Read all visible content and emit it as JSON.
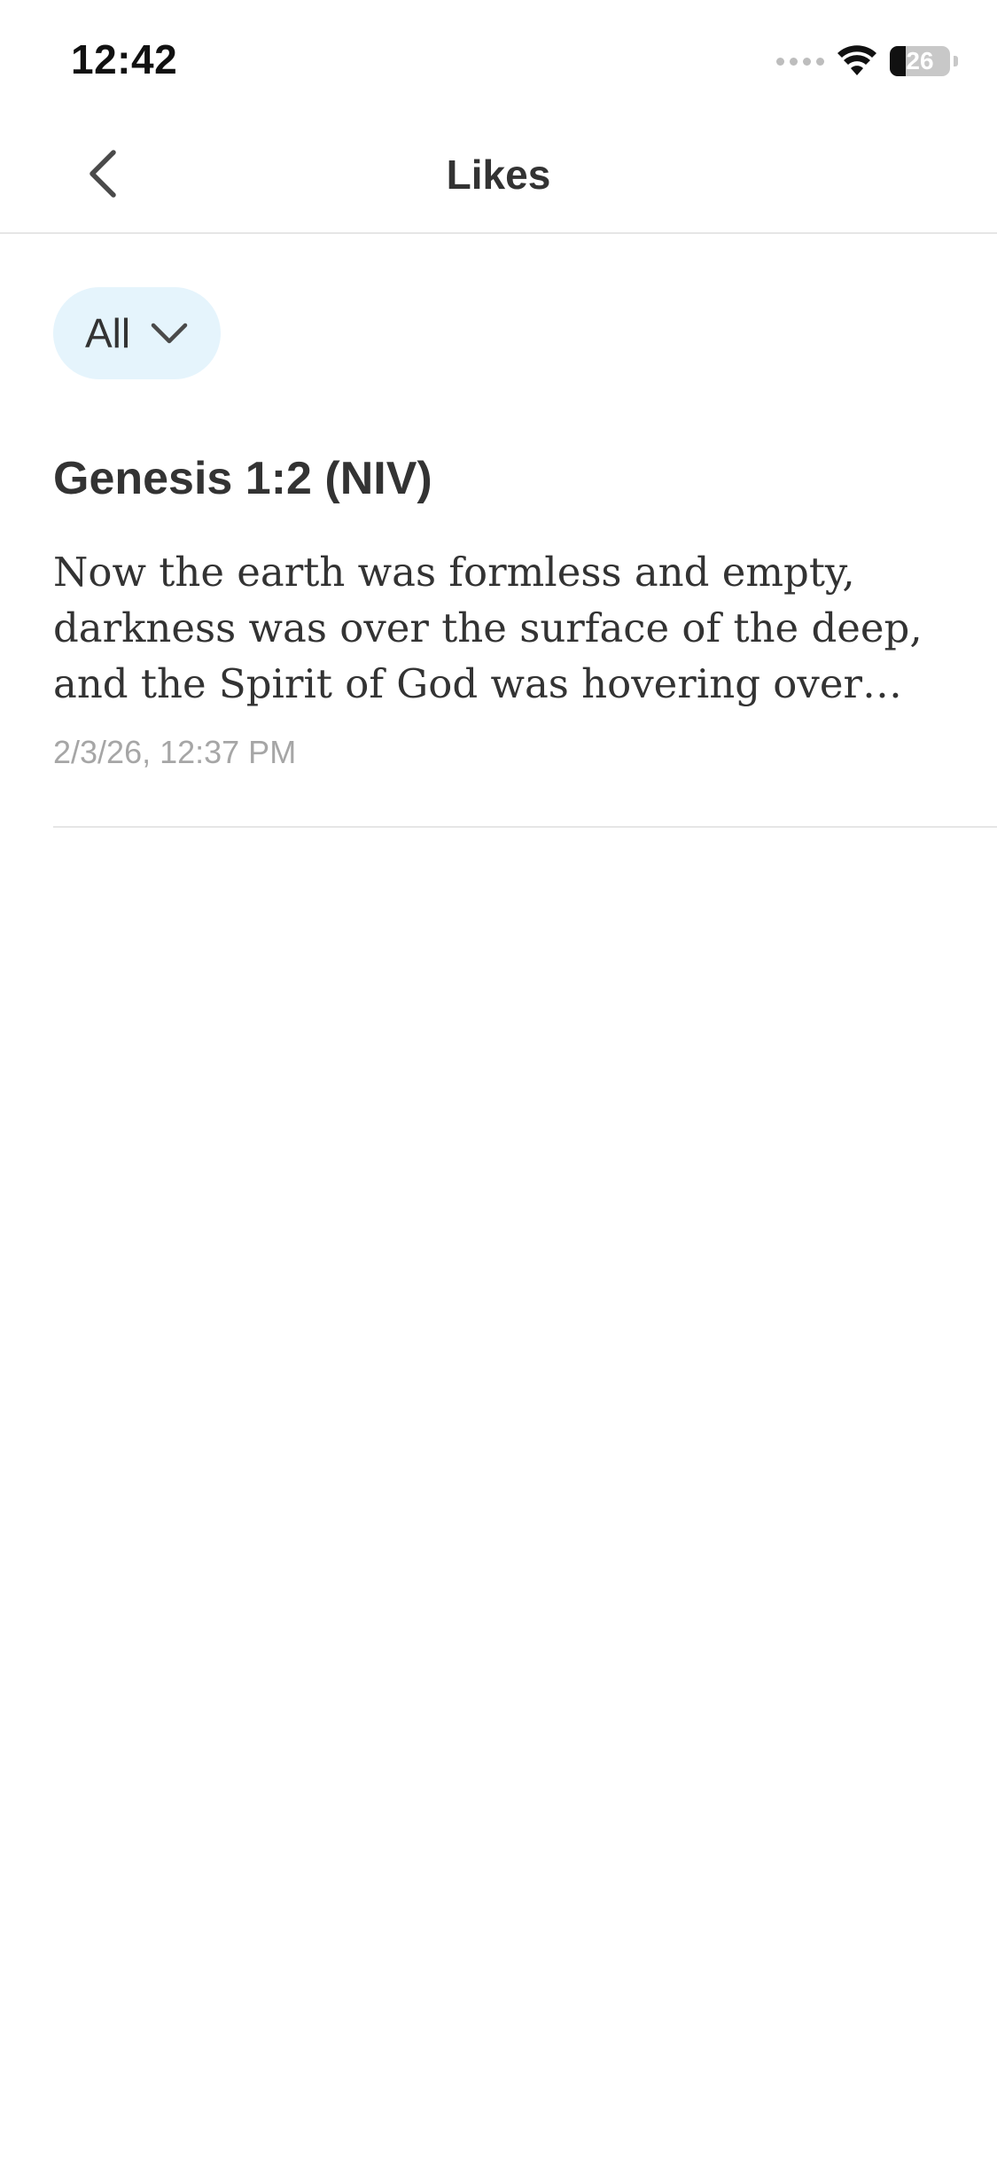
{
  "status_bar": {
    "time": "12:42",
    "battery": {
      "level_text": "26",
      "level_fraction": 0.26
    }
  },
  "nav": {
    "title": "Likes",
    "back_icon": "chevron-left-icon"
  },
  "filter": {
    "selected": "All",
    "icon": "chevron-down-icon",
    "colors": {
      "background": "#e5f4fc"
    }
  },
  "likes": [
    {
      "reference": "Genesis 1:2 (NIV)",
      "text": "Now the earth was formless and empty, darkness was over the surface of the deep, and the Spirit of God was hovering over the waters.",
      "timestamp": "2/3/26, 12:37 PM"
    }
  ]
}
